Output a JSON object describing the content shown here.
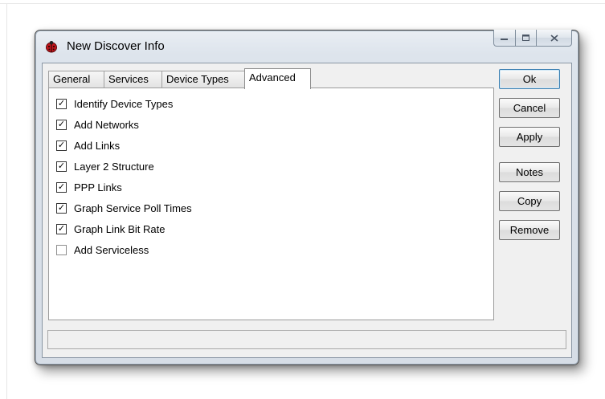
{
  "window": {
    "title": "New Discover Info",
    "icon": "ladybug-icon",
    "caption_buttons": {
      "minimize": "minimize-icon",
      "maximize": "maximize-icon",
      "close": "close-icon"
    }
  },
  "tabs": [
    {
      "label": "General",
      "active": false
    },
    {
      "label": "Services",
      "active": false
    },
    {
      "label": "Device Types",
      "active": false
    },
    {
      "label": "Advanced",
      "active": true
    }
  ],
  "options": [
    {
      "label": "Identify Device Types",
      "checked": true
    },
    {
      "label": "Add Networks",
      "checked": true
    },
    {
      "label": "Add Links",
      "checked": true
    },
    {
      "label": "Layer 2 Structure",
      "checked": true
    },
    {
      "label": "PPP Links",
      "checked": true
    },
    {
      "label": "Graph Service Poll Times",
      "checked": true
    },
    {
      "label": "Graph Link Bit Rate",
      "checked": true
    },
    {
      "label": "Add Serviceless",
      "checked": false
    }
  ],
  "buttons": {
    "ok": "Ok",
    "cancel": "Cancel",
    "apply": "Apply",
    "notes": "Notes",
    "copy": "Copy",
    "remove": "Remove"
  },
  "status_bar": {
    "text": ""
  }
}
